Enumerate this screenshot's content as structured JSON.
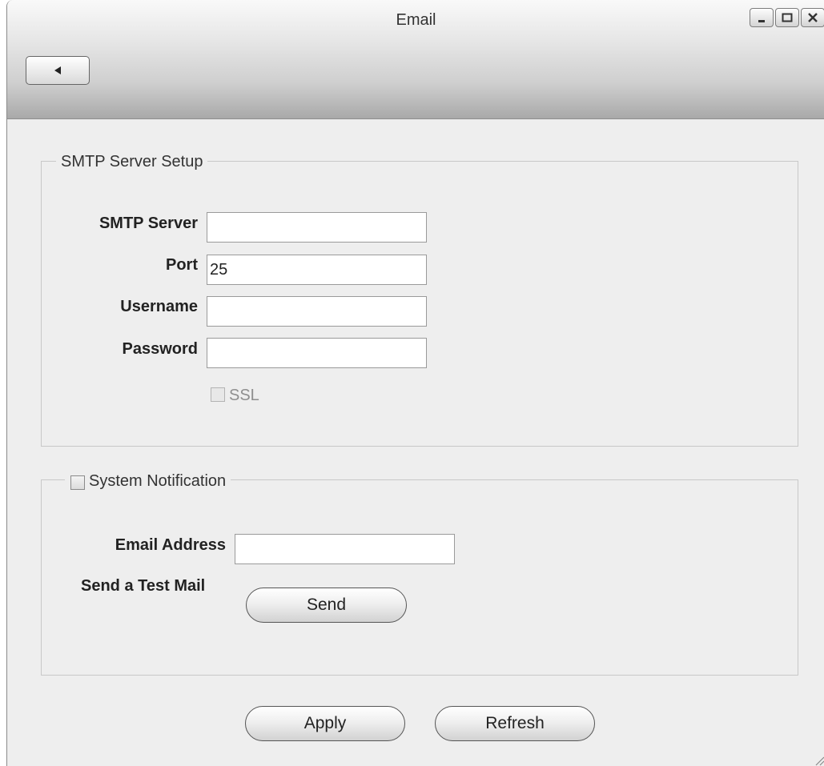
{
  "window": {
    "title": "Email",
    "controls": [
      "minimize-icon",
      "maximize-icon",
      "close-icon"
    ]
  },
  "toolbar": {
    "back_icon": "back-arrow-icon"
  },
  "smtp": {
    "legend": "SMTP Server Setup",
    "server_label": "SMTP Server",
    "server_value": "",
    "port_label": "Port",
    "port_value": "25",
    "username_label": "Username",
    "username_value": "",
    "password_label": "Password",
    "password_value": "",
    "ssl_label": "SSL",
    "ssl_checked": false,
    "ssl_disabled": true
  },
  "notification": {
    "legend": "System Notification",
    "enabled": false,
    "email_label": "Email Address",
    "email_value": "",
    "test_label": "Send a Test Mail",
    "send_label": "Send"
  },
  "footer": {
    "apply_label": "Apply",
    "refresh_label": "Refresh"
  },
  "colors": {
    "background": "#eeeeee",
    "titlebar_top": "#f9f9f9",
    "titlebar_bottom": "#a9a9a9",
    "group_border": "#c8c8c8"
  }
}
